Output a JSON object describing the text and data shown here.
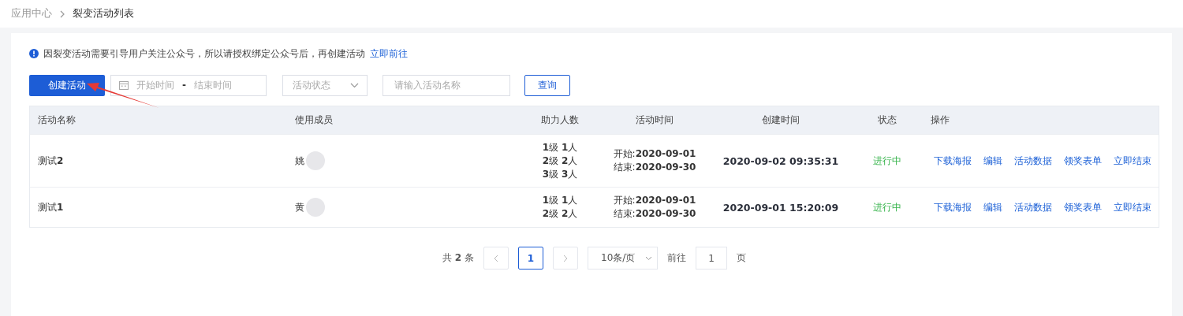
{
  "breadcrumb": {
    "items": [
      "应用中心",
      "裂变活动列表"
    ]
  },
  "notice": {
    "text": "因裂变活动需要引导用户关注公众号，所以请授权绑定公众号后，再创建活动",
    "link": "立即前往"
  },
  "toolbar": {
    "create_button": "创建活动",
    "start_placeholder": "开始时间",
    "range_separator": "-",
    "end_placeholder": "结束时间",
    "status_placeholder": "活动状态",
    "name_placeholder": "请输入活动名称",
    "query_button": "查询"
  },
  "table": {
    "columns": [
      "活动名称",
      "使用成员",
      "助力人数",
      "活动时间",
      "创建时间",
      "状态",
      "操作"
    ],
    "rows": [
      {
        "name": "测试**2**",
        "member": "姚",
        "helpers": [
          "**1**级 **1**人",
          "**2**级 **2**人",
          "**3**级 **3**人"
        ],
        "time": [
          "开始:**2020-09-01**",
          "结束:**2020-09-30**"
        ],
        "created": "2020-09-02 09:35:31",
        "status": "进行中",
        "actions": [
          "下载海报",
          "编辑",
          "活动数据",
          "领奖表单",
          "立即结束"
        ]
      },
      {
        "name": "测试**1**",
        "member": "黄",
        "helpers": [
          "**1**级 **1**人",
          "**2**级 **2**人"
        ],
        "time": [
          "开始:**2020-09-01**",
          "结束:**2020-09-30**"
        ],
        "created": "2020-09-01 15:20:09",
        "status": "进行中",
        "actions": [
          "下载海报",
          "编辑",
          "活动数据",
          "领奖表单",
          "立即结束"
        ]
      }
    ]
  },
  "pagination": {
    "total_prefix": "共",
    "total": "2",
    "total_suffix": "条",
    "pages": [
      {
        "label": "1",
        "selected": true
      }
    ],
    "page_size": "10条/页",
    "goto_label": "前往",
    "goto_value": "1",
    "goto_suffix": "页"
  }
}
